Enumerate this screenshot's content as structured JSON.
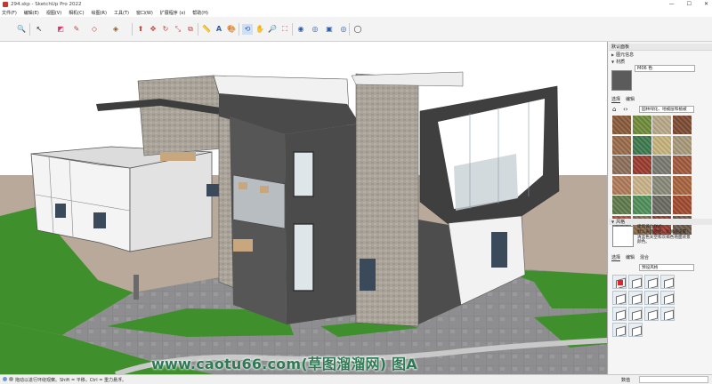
{
  "window": {
    "title": "294.skp - SketchUp Pro 2022",
    "controls": [
      "—",
      "☐",
      "✕"
    ]
  },
  "menu": [
    "文件(F)",
    "编辑(E)",
    "视图(V)",
    "相机(C)",
    "绘图(R)",
    "工具(T)",
    "窗口(W)",
    "扩展程序 (x)",
    "帮助(H)"
  ],
  "toolbar": {
    "tools": [
      {
        "name": "zoom-extents-icon",
        "glyph": "🔍"
      },
      {
        "name": "select-icon",
        "glyph": "↖"
      },
      {
        "name": "eraser-icon",
        "glyph": "◩"
      },
      {
        "name": "line-icon",
        "glyph": "✎"
      },
      {
        "name": "shape-icon",
        "glyph": "◇"
      },
      {
        "name": "paint-bucket-icon",
        "glyph": "◈"
      },
      {
        "name": "push-pull-icon",
        "glyph": "⬆"
      },
      {
        "name": "move-icon",
        "glyph": "✥"
      },
      {
        "name": "rotate-icon",
        "glyph": "↻"
      },
      {
        "name": "scale-icon",
        "glyph": "⤡"
      },
      {
        "name": "offset-icon",
        "glyph": "⧉"
      },
      {
        "name": "tape-measure-icon",
        "glyph": "📏"
      },
      {
        "name": "text-icon",
        "glyph": "A"
      },
      {
        "name": "paint-icon",
        "glyph": "🎨"
      },
      {
        "name": "orbit-icon",
        "glyph": "⟲"
      },
      {
        "name": "pan-icon",
        "glyph": "✋"
      },
      {
        "name": "zoom-icon",
        "glyph": "🔎"
      },
      {
        "name": "zoom-window-icon",
        "glyph": "⛶"
      },
      {
        "name": "warehouse-icon",
        "glyph": "◉"
      },
      {
        "name": "extension-icon",
        "glyph": "◎"
      },
      {
        "name": "layout-icon",
        "glyph": "▣"
      },
      {
        "name": "account-icon",
        "glyph": "◯"
      }
    ]
  },
  "panel": {
    "tray_title": "默认面板",
    "entity_info": "图元信息",
    "materials": "材质",
    "material_name": "M06 色",
    "tabs_select": "选择",
    "tabs_edit": "编辑",
    "material_category": "园林绿化、地被层和植被",
    "styles": "风格",
    "style_name": "建筑设计样式",
    "style_desc": "默认表面颜色，轮廓线设置；清蓝色天空和灰褐色地面背景颜色。",
    "style_tab_select": "选择",
    "style_tab_edit": "编辑",
    "style_tab_mix": "混合",
    "style_category": "预设风格"
  },
  "materials_swatches": [
    "#8a5a3a",
    "#6f8c3a",
    "#b8a98a",
    "#7d4a33",
    "#9a6b4a",
    "#3e7a4e",
    "#c7b37a",
    "#a89a7a",
    "#8c6f5a",
    "#9b3b2f",
    "#7a7a72",
    "#a05a3e",
    "#b07a5a",
    "#c9b48a",
    "#8a8a7a",
    "#a8643f",
    "#5f7a4a",
    "#4f8f5a",
    "#6a6a62",
    "#a04a2f",
    "#b84a3a",
    "#8a6a4a",
    "#9a3b2f",
    "#6e5a4a"
  ],
  "status": {
    "text": "拖动以进行环绕观察。Shift = 平移，Ctrl = 重力悬浮。",
    "measure_label": "数值"
  },
  "watermark": "www.caotu66.com(草图溜溜网) 图A"
}
